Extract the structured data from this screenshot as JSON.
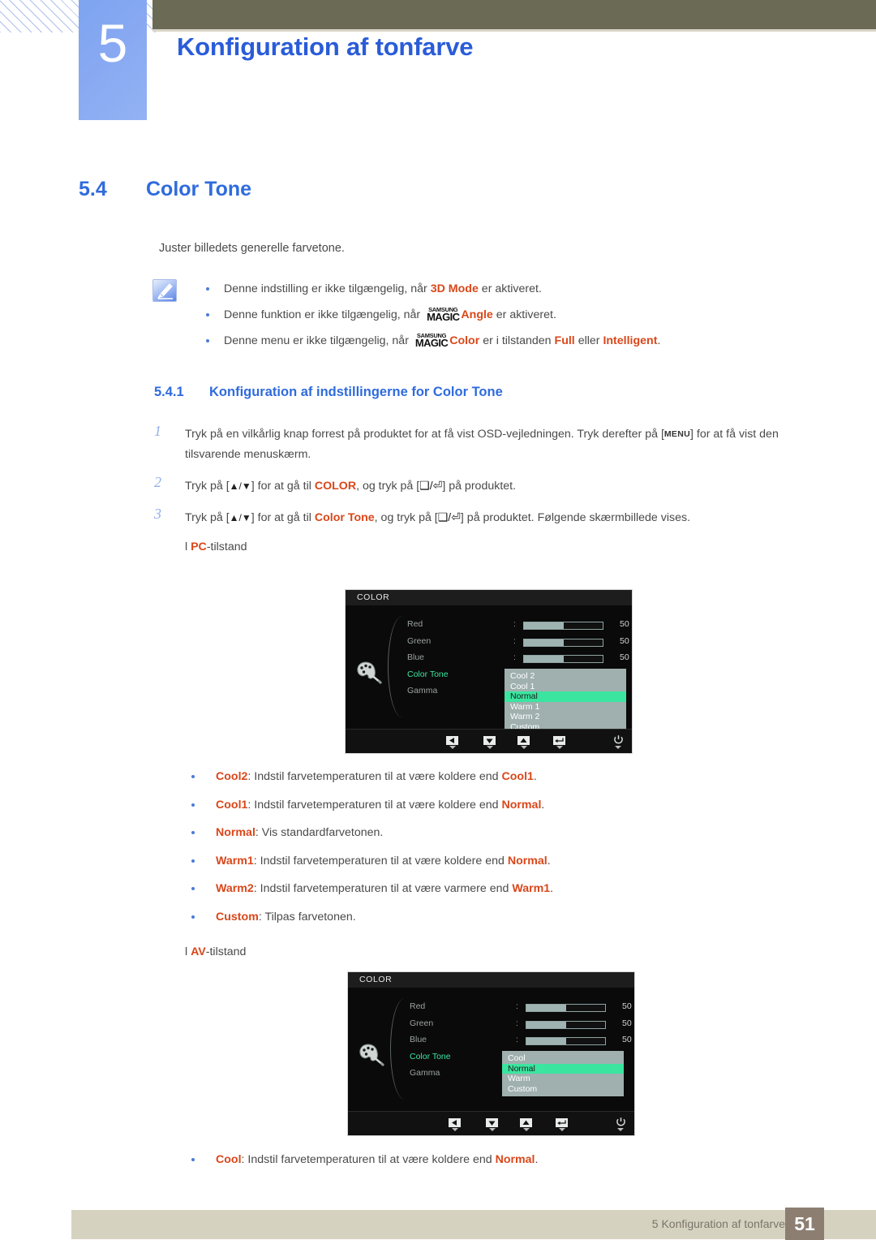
{
  "header": {
    "chapter_number": "5",
    "chapter_title": "Konfiguration af tonfarve"
  },
  "section": {
    "number": "5.4",
    "title": "Color Tone",
    "intro": "Juster billedets generelle farvetone."
  },
  "note": {
    "icon": "note-pencil-icon",
    "items": [
      {
        "pre": "Denne indstilling er ikke tilgængelig, når ",
        "highlight": "3D Mode",
        "post": " er aktiveret.",
        "magic": false
      },
      {
        "pre": "Denne funktion er ikke tilgængelig, når ",
        "magic": true,
        "magic_top": "SAMSUNG",
        "magic_bottom": "MAGIC",
        "highlight": "Angle",
        "post": " er aktiveret."
      },
      {
        "pre": "Denne menu er ikke tilgængelig, når ",
        "magic": true,
        "magic_top": "SAMSUNG",
        "magic_bottom": "MAGIC",
        "highlight": "Color",
        "mid": " er i tilstanden ",
        "highlight2": "Full",
        "mid2": " eller ",
        "highlight3": "Intelligent",
        "post": "."
      }
    ]
  },
  "subsection": {
    "number": "5.4.1",
    "title": "Konfiguration af indstillingerne for Color Tone"
  },
  "steps": [
    {
      "n": "1",
      "p1": "Tryk på en vilkårlig knap forrest på produktet for at få vist OSD-vejledningen. Tryk derefter på [",
      "key": "MENU",
      "p2": "] for at få vist den tilsvarende menuskærm."
    },
    {
      "n": "2",
      "p1": "Tryk på [",
      "arrows": "▲/▼",
      "p2": "] for at gå til ",
      "hl": "COLOR",
      "p3": ", og tryk på [",
      "glyphs": "❑/⏎",
      "p4": "] på produktet."
    },
    {
      "n": "3",
      "p1": "Tryk på [",
      "arrows": "▲/▼",
      "p2": "] for at gå til ",
      "hl": "Color Tone",
      "p3": ", og tryk på [",
      "glyphs": "❑/⏎",
      "p4": "] på produktet. Følgende skærmbillede vises."
    }
  ],
  "mode_labels": {
    "pc": {
      "prefix": "l ",
      "hl": "PC",
      "suffix": "-tilstand"
    },
    "av": {
      "prefix": "l ",
      "hl": "AV",
      "suffix": "-tilstand"
    }
  },
  "osd_pc": {
    "title": "COLOR",
    "palette_icon": "palette-icon",
    "rows": [
      {
        "label": "Red",
        "colon": ":",
        "value": "50",
        "fill": 51,
        "active": false,
        "slider": true
      },
      {
        "label": "Green",
        "colon": ":",
        "value": "50",
        "fill": 51,
        "active": false,
        "slider": true
      },
      {
        "label": "Blue",
        "colon": ":",
        "value": "50",
        "fill": 51,
        "active": false,
        "slider": true
      },
      {
        "label": "Color Tone",
        "colon": ":",
        "value": "",
        "fill": 0,
        "active": true,
        "slider": false
      },
      {
        "label": "Gamma",
        "colon": ":",
        "value": "",
        "fill": 0,
        "active": false,
        "slider": false
      }
    ],
    "dropdown": {
      "options": [
        "Cool 2",
        "Cool 1",
        "Normal",
        "Warm 1",
        "Warm 2",
        "Custom"
      ],
      "selected": "Normal"
    },
    "toolbar_icons": [
      "back-arrow-icon",
      "down-arrow-icon",
      "up-arrow-icon",
      "enter-icon",
      "power-icon"
    ]
  },
  "osd_av": {
    "title": "COLOR",
    "palette_icon": "palette-icon",
    "rows": [
      {
        "label": "Red",
        "colon": ":",
        "value": "50",
        "fill": 51,
        "active": false,
        "slider": true
      },
      {
        "label": "Green",
        "colon": ":",
        "value": "50",
        "fill": 51,
        "active": false,
        "slider": true
      },
      {
        "label": "Blue",
        "colon": ":",
        "value": "50",
        "fill": 51,
        "active": false,
        "slider": true
      },
      {
        "label": "Color Tone",
        "colon": ":",
        "value": "",
        "fill": 0,
        "active": true,
        "slider": false
      },
      {
        "label": "Gamma",
        "colon": ":",
        "value": "",
        "fill": 0,
        "active": false,
        "slider": false
      }
    ],
    "dropdown": {
      "options": [
        "Cool",
        "Normal",
        "Warm",
        "Custom"
      ],
      "selected": "Normal"
    },
    "toolbar_icons": [
      "back-arrow-icon",
      "down-arrow-icon",
      "up-arrow-icon",
      "enter-icon",
      "power-icon"
    ]
  },
  "pc_options": [
    {
      "term": "Cool2",
      "desc": ": Indstil farvetemperaturen til at være koldere end ",
      "ref": "Cool1",
      "end": "."
    },
    {
      "term": "Cool1",
      "desc": ": Indstil farvetemperaturen til at være koldere end ",
      "ref": "Normal",
      "end": "."
    },
    {
      "term": "Normal",
      "desc": ": Vis standardfarvetonen.",
      "ref": "",
      "end": ""
    },
    {
      "term": "Warm1",
      "desc": ": Indstil farvetemperaturen til at være koldere end ",
      "ref": "Normal",
      "end": "."
    },
    {
      "term": "Warm2",
      "desc": ": Indstil farvetemperaturen til at være varmere end ",
      "ref": "Warm1",
      "end": "."
    },
    {
      "term": "Custom",
      "desc": ": Tilpas farvetonen.",
      "ref": "",
      "end": ""
    }
  ],
  "av_options": [
    {
      "term": "Cool",
      "desc": ": Indstil farvetemperaturen til at være koldere end ",
      "ref": "Normal",
      "end": "."
    }
  ],
  "footer": {
    "text": "5 Konfiguration af tonfarve",
    "page": "51"
  },
  "colors": {
    "accent_blue": "#2f6bdd",
    "orange": "#d9471a",
    "olive": "#6b6b55",
    "footer_bar": "#d6d2c0",
    "footer_page_box": "#8c7f72",
    "osd_highlight_green": "#3be5a0",
    "osd_dropdown_bg": "#9fb0ae"
  }
}
